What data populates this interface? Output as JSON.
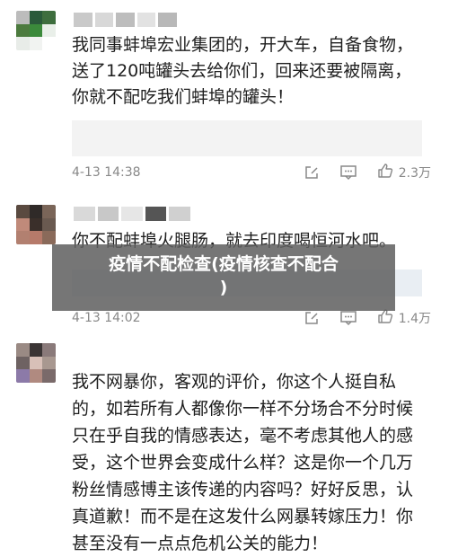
{
  "comments": [
    {
      "text": "我同事蚌埠宏业集团的，开大车，自备食物，\n送了120吨罐头去给你们，回来还要被隔离，\n你就不配吃我们蚌埠的罐头！",
      "time": "4-13 14:38",
      "likes": "2.3万"
    },
    {
      "text": "你不配蚌埠火腿肠，就去印度喝恒河水吧。",
      "time": "4-13 14:02",
      "likes": "1.4万"
    },
    {
      "text": "我不网暴你，客观的评价，你这个人挺自私\n的，如若所有人都像你一样不分场合不分时候\n只在乎自我的情感表达，毫不考虑其他人的感\n受，这个世界会变成什么样？这是你一个几万\n粉丝情感博主该传递的内容吗？好好反思，认\n真道歉！而不是在这发什么网暴转嫁压力！你\n甚至没有一点点危机公关的能力！"
    }
  ],
  "banner": {
    "text": "疫情不配检查(疫情核查不配合\n)"
  },
  "icons": {
    "edit": "edit-icon",
    "comment": "comment-icon",
    "like": "thumbs-up-icon"
  },
  "colors": {
    "meta": "#888888",
    "banner_bg": "#5f5f5f"
  }
}
